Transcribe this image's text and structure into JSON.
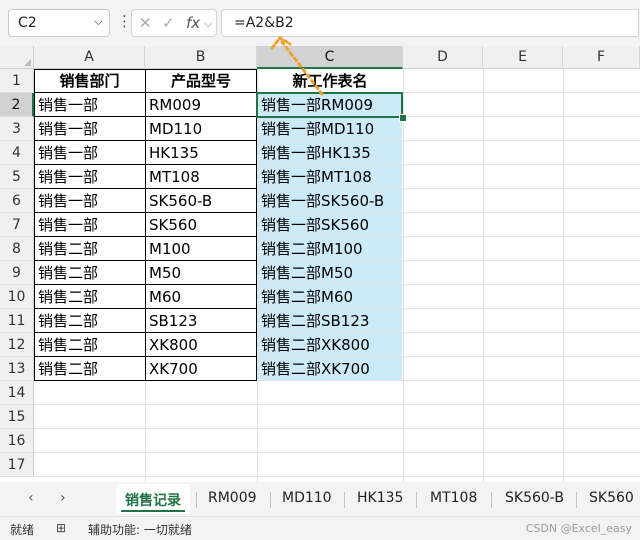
{
  "formula_bar": {
    "name_box": "C2",
    "cancel_icon": "✕",
    "enter_icon": "✓",
    "fx_label": "fx",
    "formula": "=A2&B2"
  },
  "columns": [
    "A",
    "B",
    "C",
    "D",
    "E",
    "F"
  ],
  "rows": [
    "1",
    "2",
    "3",
    "4",
    "5",
    "6",
    "7",
    "8",
    "9",
    "10",
    "11",
    "12",
    "13",
    "14",
    "15",
    "16",
    "17"
  ],
  "headers": {
    "a": "销售部门",
    "b": "产品型号",
    "c": "新工作表名"
  },
  "data": [
    {
      "a": "销售一部",
      "b": "RM009",
      "c": "销售一部RM009"
    },
    {
      "a": "销售一部",
      "b": "MD110",
      "c": "销售一部MD110"
    },
    {
      "a": "销售一部",
      "b": "HK135",
      "c": "销售一部HK135"
    },
    {
      "a": "销售一部",
      "b": "MT108",
      "c": "销售一部MT108"
    },
    {
      "a": "销售一部",
      "b": "SK560-B",
      "c": "销售一部SK560-B"
    },
    {
      "a": "销售一部",
      "b": "SK560",
      "c": "销售一部SK560"
    },
    {
      "a": "销售二部",
      "b": "M100",
      "c": "销售二部M100"
    },
    {
      "a": "销售二部",
      "b": "M50",
      "c": "销售二部M50"
    },
    {
      "a": "销售二部",
      "b": "M60",
      "c": "销售二部M60"
    },
    {
      "a": "销售二部",
      "b": "SB123",
      "c": "销售二部SB123"
    },
    {
      "a": "销售二部",
      "b": "XK800",
      "c": "销售二部XK800"
    },
    {
      "a": "销售二部",
      "b": "XK700",
      "c": "销售二部XK700"
    }
  ],
  "sheet_tabs": [
    "销售记录",
    "RM009",
    "MD110",
    "HK135",
    "MT108",
    "SK560-B",
    "SK560"
  ],
  "status": {
    "ready": "就绪",
    "accessibility": "辅助功能: 一切就绪",
    "watermark": "CSDN @Excel_easy"
  },
  "colors": {
    "accent": "#217346",
    "highlight": "#cdeaf8",
    "arrow": "#f0a030"
  }
}
